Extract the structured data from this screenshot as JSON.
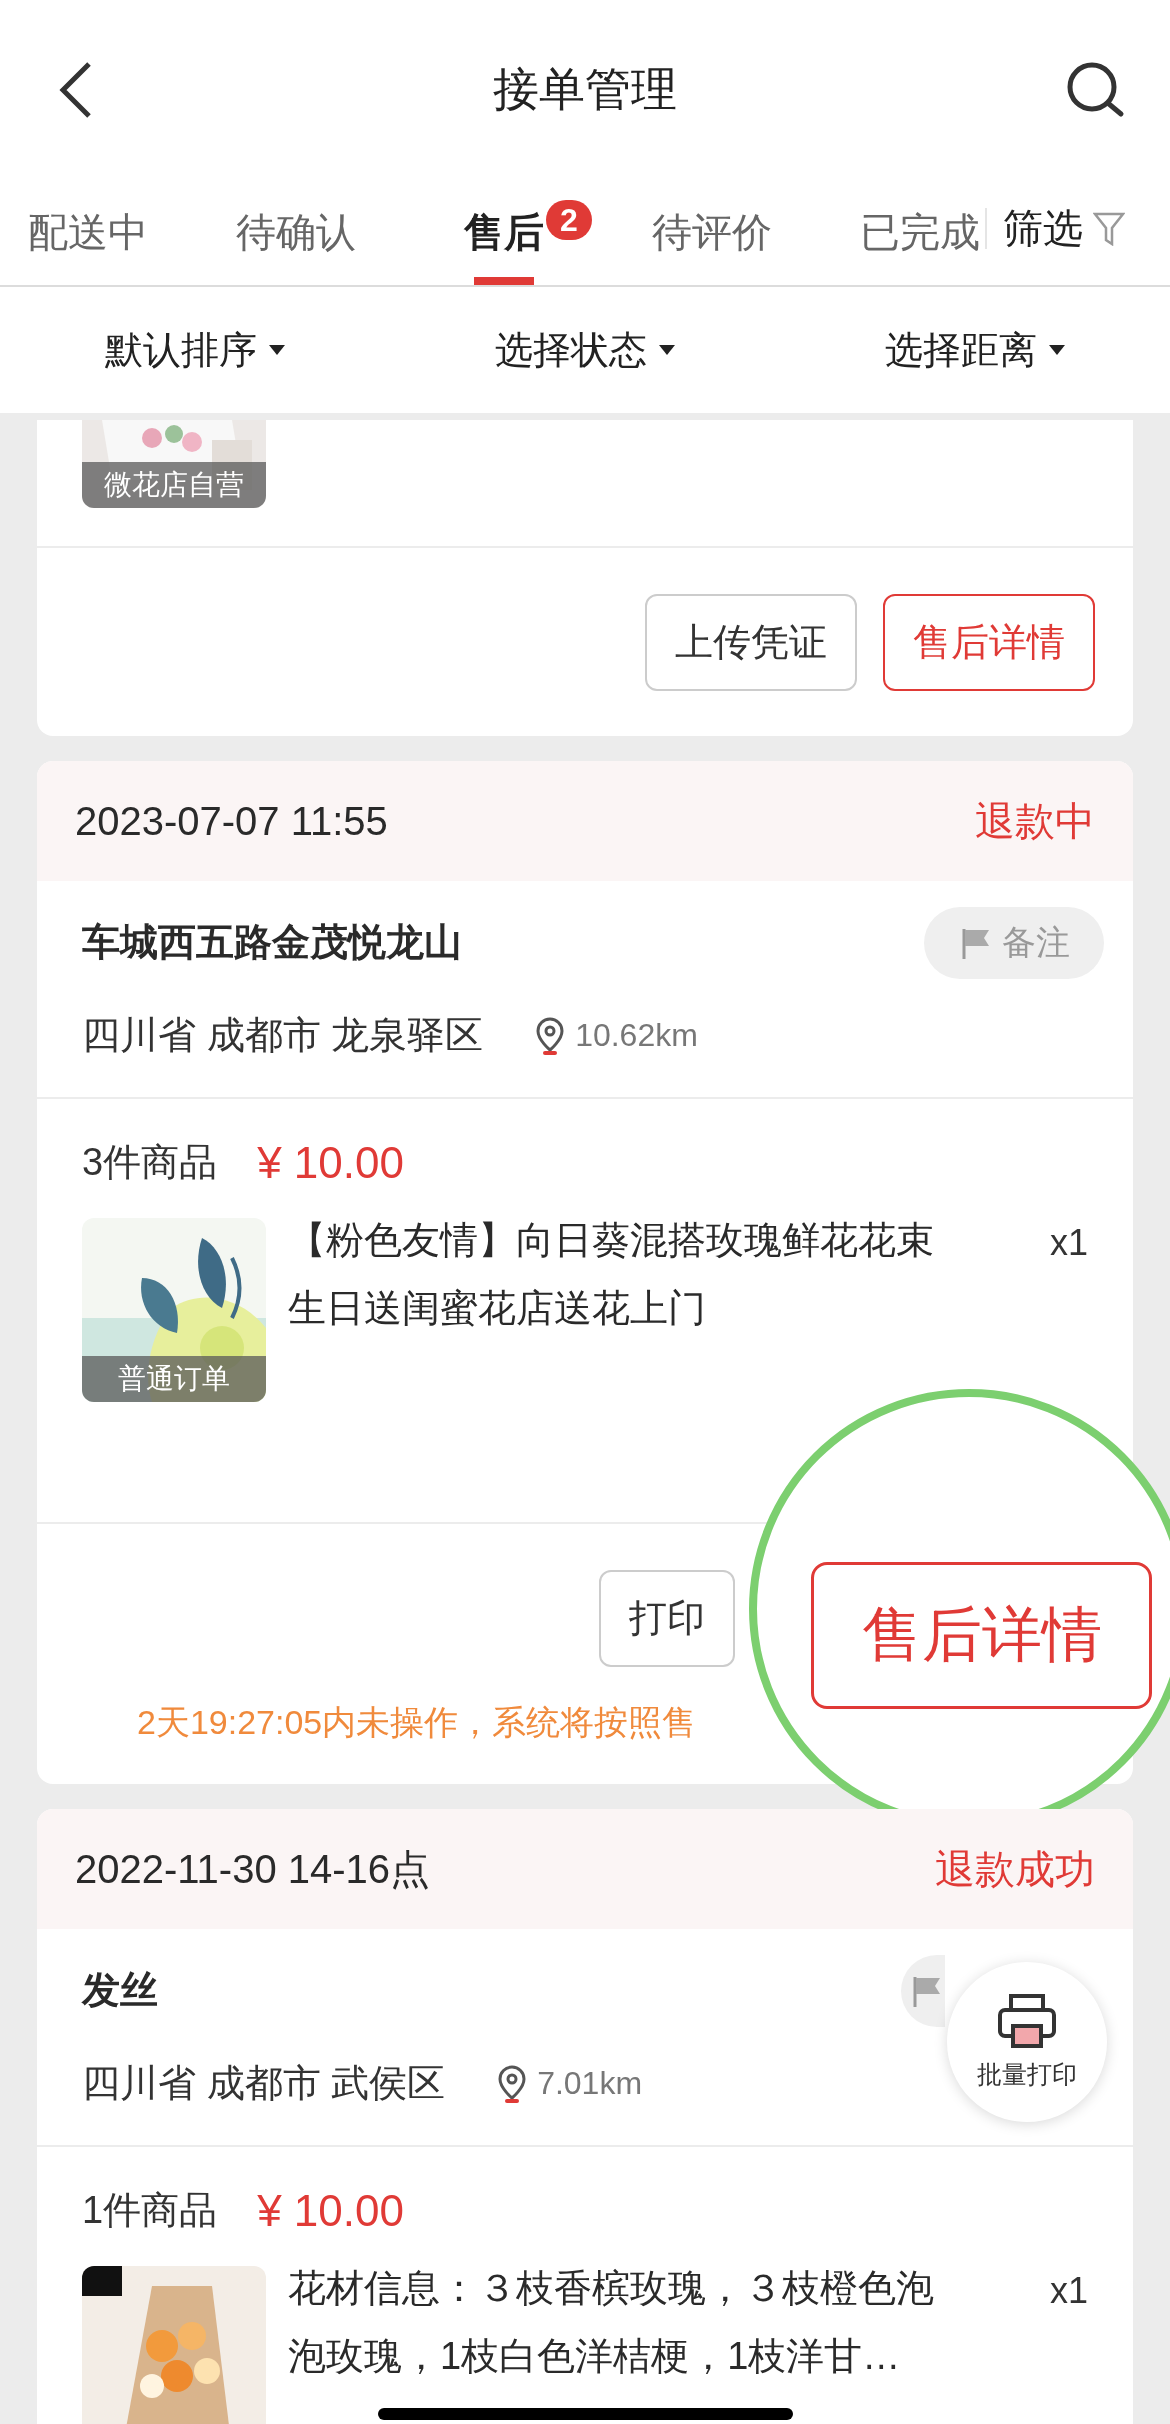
{
  "nav": {
    "title": "接单管理"
  },
  "tabs": [
    {
      "label": "配送中",
      "selected": false
    },
    {
      "label": "待确认",
      "selected": false
    },
    {
      "label": "售后",
      "selected": true,
      "badge": "2"
    },
    {
      "label": "待评价",
      "selected": false
    },
    {
      "label": "已完成",
      "selected": false
    }
  ],
  "filter_button": "筛选",
  "sort_options": [
    "默认排序",
    "选择状态",
    "选择距离"
  ],
  "partial_order": {
    "image_tag": "微花店自营",
    "actions": [
      {
        "label": "上传凭证",
        "primary": false
      },
      {
        "label": "售后详情",
        "primary": true
      }
    ]
  },
  "orders": [
    {
      "date": "2023-07-07 11:55",
      "status": "退款中",
      "place": "车城西五路金茂悦龙山",
      "note": true,
      "note_label": "备注",
      "region": "四川省 成都市 龙泉驿区",
      "distance": "10.62km",
      "goods_count": "3件商品",
      "price": "¥ 10.00",
      "items": [
        {
          "title": "【粉色友情】向日葵混搭玫瑰鲜花花束生日送闺蜜花店送花上门",
          "qty": "x1",
          "tag": "普通订单",
          "kind": "leaves"
        }
      ],
      "actions": [
        {
          "label": "打印",
          "primary": false
        }
      ],
      "notice": "2天19:27:05内未操作，系统将按照售",
      "magnifier": {
        "label": "售后详情"
      }
    },
    {
      "date": "2022-11-30 14-16点",
      "status": "退款成功",
      "place": "发丝",
      "note": true,
      "region": "四川省 成都市 武侯区",
      "distance": "7.01km",
      "goods_count": "1件商品",
      "price": "¥ 10.00",
      "items": [
        {
          "title": "花材信息：３枝香槟玫瑰，３枝橙色泡泡玫瑰，1枝白色洋桔梗，1枝洋甘…",
          "qty": "x1",
          "kind": "bouquet"
        }
      ]
    }
  ],
  "float_button": {
    "label": "批量打印"
  }
}
